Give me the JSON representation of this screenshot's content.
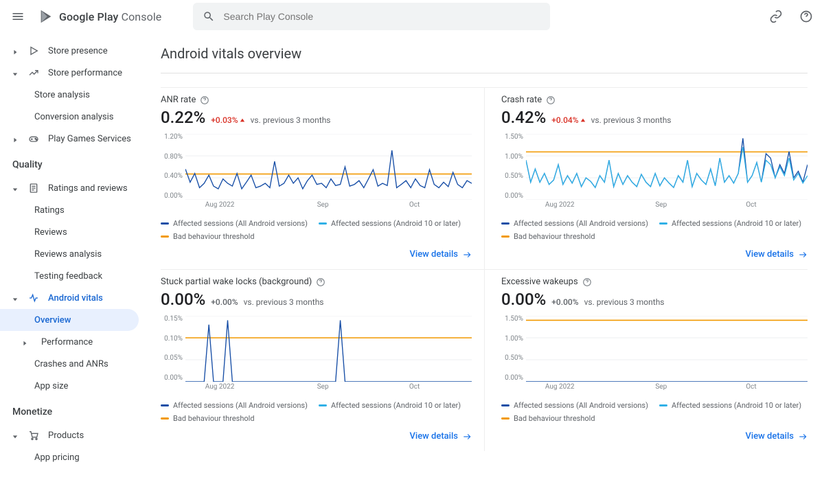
{
  "header": {
    "brand1": "Google Play ",
    "brand2": "Console",
    "search_placeholder": "Search Play Console"
  },
  "sidebar": {
    "groups": [
      {
        "items": [
          {
            "chevron": "right",
            "icon": "play",
            "label": "Store presence"
          },
          {
            "chevron": "down",
            "icon": "trend",
            "label": "Store performance"
          },
          {
            "sub": true,
            "label": "Store analysis"
          },
          {
            "sub": true,
            "label": "Conversion analysis"
          },
          {
            "chevron": "right",
            "icon": "game",
            "label": "Play Games Services"
          }
        ]
      },
      {
        "header": "Quality",
        "items": [
          {
            "chevron": "down",
            "icon": "doc",
            "label": "Ratings and reviews"
          },
          {
            "sub": true,
            "label": "Ratings"
          },
          {
            "sub": true,
            "label": "Reviews"
          },
          {
            "sub": true,
            "label": "Reviews analysis"
          },
          {
            "sub": true,
            "label": "Testing feedback"
          },
          {
            "chevron": "down",
            "icon": "vitals",
            "label": "Android vitals",
            "active": true
          },
          {
            "sub": true,
            "label": "Overview",
            "selected": true
          },
          {
            "sub": true,
            "chevron": "right",
            "label": "Performance"
          },
          {
            "sub": true,
            "label": "Crashes and ANRs"
          },
          {
            "sub": true,
            "label": "App size"
          }
        ]
      },
      {
        "header": "Monetize",
        "items": [
          {
            "chevron": "down",
            "icon": "cart",
            "label": "Products"
          },
          {
            "sub": true,
            "label": "App pricing"
          }
        ]
      }
    ]
  },
  "page": {
    "title": "Android vitals overview",
    "details_label": "View details",
    "xlabels": [
      "Aug 2022",
      "Sep",
      "Oct"
    ],
    "legend": [
      {
        "color": "#174ea6",
        "label": "Affected sessions (All Android versions)"
      },
      {
        "color": "#30b0e6",
        "label": "Affected sessions (Android 10 or later)"
      },
      {
        "color": "#f29900",
        "label": "Bad behaviour threshold"
      }
    ]
  },
  "cards": [
    {
      "title": "ANR rate",
      "value": "0.22%",
      "delta": "+0.03%",
      "dir": "up",
      "sub": "vs. previous 3 months"
    },
    {
      "title": "Crash rate",
      "value": "0.42%",
      "delta": "+0.04%",
      "dir": "up",
      "sub": "vs. previous 3 months"
    },
    {
      "title": "Stuck partial wake locks (background)",
      "value": "0.00%",
      "delta": "+0.00%",
      "dir": "flat",
      "sub": "vs. previous 3 months"
    },
    {
      "title": "Excessive wakeups",
      "value": "0.00%",
      "delta": "+0.00%",
      "dir": "flat",
      "sub": "vs. previous 3 months"
    }
  ],
  "chart_data": [
    {
      "type": "line",
      "title": "ANR rate",
      "ylim": [
        0,
        1.2
      ],
      "yticks": [
        "1.20%",
        "0.80%",
        "0.40%",
        "0.00%"
      ],
      "threshold": 0.47,
      "series": [
        {
          "name": "all",
          "values": [
            0.56,
            0.32,
            0.48,
            0.22,
            0.3,
            0.45,
            0.25,
            0.2,
            0.38,
            0.3,
            0.25,
            0.48,
            0.2,
            0.32,
            0.45,
            0.22,
            0.25,
            0.3,
            0.22,
            0.7,
            0.25,
            0.3,
            0.45,
            0.3,
            0.4,
            0.2,
            0.35,
            0.45,
            0.28,
            0.3,
            0.22,
            0.38,
            0.26,
            0.28,
            0.6,
            0.25,
            0.28,
            0.35,
            0.22,
            0.38,
            0.55,
            0.25,
            0.3,
            0.26,
            0.9,
            0.22,
            0.28,
            0.35,
            0.22,
            0.38,
            0.26,
            0.22,
            0.55,
            0.28,
            0.22,
            0.32,
            0.24,
            0.5,
            0.28,
            0.22,
            0.35,
            0.3
          ]
        }
      ]
    },
    {
      "type": "line",
      "title": "Crash rate",
      "ylim": [
        0,
        1.5
      ],
      "yticks": [
        "1.50%",
        "1.00%",
        "0.50%",
        "0.00%"
      ],
      "threshold": 1.09,
      "series": [
        {
          "name": "all",
          "values": [
            0.9,
            0.4,
            0.7,
            0.4,
            0.6,
            0.35,
            0.45,
            0.8,
            0.35,
            0.55,
            0.38,
            0.6,
            0.3,
            0.5,
            0.42,
            0.28,
            0.55,
            0.4,
            0.9,
            0.3,
            0.6,
            0.35,
            0.55,
            0.4,
            0.3,
            0.58,
            0.4,
            0.3,
            0.6,
            0.32,
            0.5,
            0.38,
            0.28,
            0.55,
            0.4,
            0.9,
            0.3,
            0.6,
            0.45,
            0.35,
            0.7,
            0.32,
            0.95,
            0.4,
            0.55,
            0.38,
            0.6,
            1.4,
            0.4,
            0.55,
            0.85,
            0.4,
            1.05,
            0.95,
            0.5,
            0.8,
            0.6,
            1.1,
            0.5,
            0.65,
            0.4,
            0.8
          ]
        },
        {
          "name": "a10",
          "values": [
            0.9,
            0.4,
            0.7,
            0.4,
            0.6,
            0.35,
            0.45,
            0.8,
            0.35,
            0.55,
            0.38,
            0.6,
            0.3,
            0.5,
            0.42,
            0.28,
            0.55,
            0.4,
            0.9,
            0.3,
            0.6,
            0.35,
            0.55,
            0.4,
            0.3,
            0.58,
            0.4,
            0.3,
            0.6,
            0.32,
            0.5,
            0.38,
            0.28,
            0.55,
            0.4,
            0.9,
            0.3,
            0.6,
            0.45,
            0.35,
            0.7,
            0.32,
            0.95,
            0.4,
            0.55,
            0.38,
            0.6,
            1.2,
            0.4,
            0.55,
            0.85,
            0.4,
            0.9,
            0.8,
            0.5,
            0.75,
            0.55,
            0.95,
            0.45,
            0.6,
            0.38,
            0.55
          ]
        }
      ]
    },
    {
      "type": "line",
      "title": "Stuck partial wake locks (background)",
      "ylim": [
        0,
        0.15
      ],
      "yticks": [
        "0.15%",
        "0.10%",
        "0.05%",
        "0.00%"
      ],
      "threshold": 0.1,
      "series": [
        {
          "name": "all",
          "values": [
            0,
            0,
            0,
            0,
            0,
            0.13,
            0,
            0,
            0,
            0.14,
            0,
            0,
            0,
            0,
            0,
            0,
            0,
            0,
            0,
            0,
            0,
            0,
            0,
            0,
            0,
            0,
            0,
            0,
            0,
            0,
            0,
            0,
            0,
            0.14,
            0,
            0,
            0,
            0,
            0,
            0,
            0,
            0,
            0,
            0,
            0,
            0,
            0,
            0,
            0,
            0,
            0,
            0,
            0,
            0,
            0,
            0,
            0,
            0,
            0,
            0,
            0,
            0
          ]
        }
      ]
    },
    {
      "type": "line",
      "title": "Excessive wakeups",
      "ylim": [
        0,
        1.5
      ],
      "yticks": [
        "1.50%",
        "1.00%",
        "0.50%",
        "0.00%"
      ],
      "threshold": 1.4,
      "series": [
        {
          "name": "all",
          "values": [
            0,
            0,
            0,
            0,
            0,
            0,
            0,
            0,
            0,
            0,
            0,
            0,
            0,
            0,
            0,
            0,
            0,
            0,
            0,
            0,
            0,
            0,
            0,
            0,
            0,
            0,
            0,
            0,
            0,
            0,
            0,
            0,
            0,
            0,
            0,
            0,
            0,
            0,
            0,
            0,
            0,
            0,
            0,
            0,
            0,
            0,
            0,
            0,
            0,
            0,
            0,
            0,
            0,
            0,
            0,
            0,
            0,
            0,
            0,
            0,
            0,
            0
          ]
        }
      ]
    }
  ]
}
